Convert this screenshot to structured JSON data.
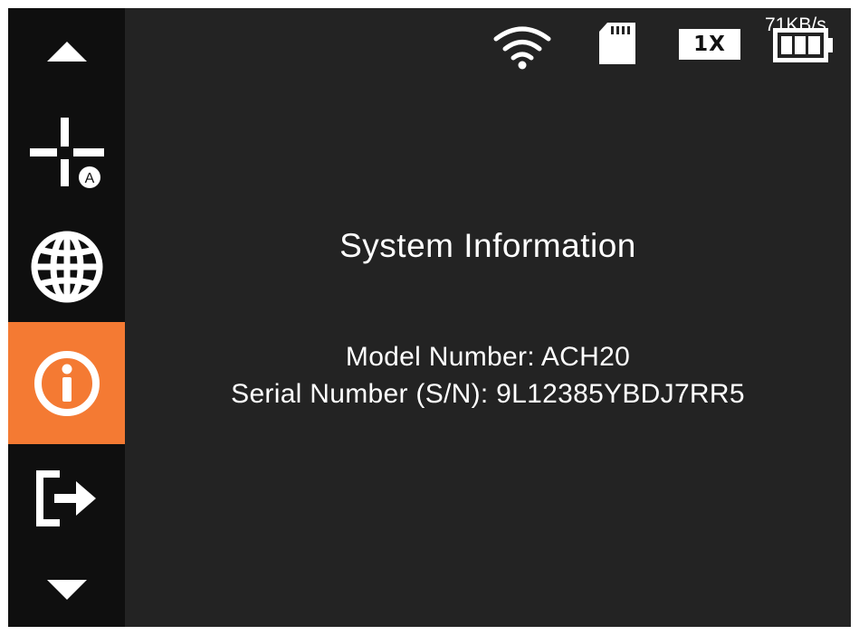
{
  "sidebar": {
    "items": [
      {
        "icon": "triangle-up-icon"
      },
      {
        "icon": "crosshair-auto-icon",
        "badge": "A"
      },
      {
        "icon": "globe-icon"
      },
      {
        "icon": "info-icon",
        "active": true
      },
      {
        "icon": "exit-arrow-icon"
      },
      {
        "icon": "triangle-down-icon"
      }
    ],
    "active_color": "#f47a33"
  },
  "status_bar": {
    "wifi": "wifi-icon",
    "sd_card": "sd-card-icon",
    "zoom": "1X",
    "battery": "battery-icon",
    "battery_level": 1.0,
    "rate": "71KB/s"
  },
  "main": {
    "title": "System Information",
    "model_line": "Model Number: ACH20",
    "serial_line": "Serial Number (S/N): 9L12385YBDJ7RR5"
  }
}
